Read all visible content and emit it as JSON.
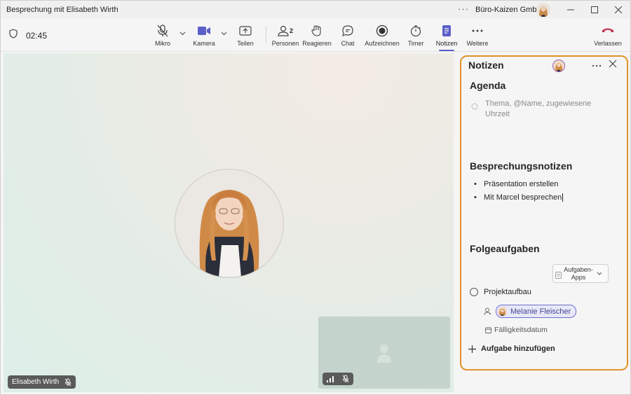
{
  "window": {
    "title": "Besprechung mit Elisabeth Wirth",
    "more": "···",
    "org": "Büro-Kaizen GmbH"
  },
  "toolbar": {
    "elapsed": "02:45",
    "mic_label": "Mikro",
    "camera_label": "Kamera",
    "share_label": "Teilen",
    "people_label": "Personen",
    "people_count": "2",
    "react_label": "Reagieren",
    "chat_label": "Chat",
    "record_label": "Aufzeichnen",
    "timer_label": "Timer",
    "notes_label": "Notizen",
    "more_label": "Weitere",
    "leave_label": "Verlassen",
    "accent_color": "#5b5fc7",
    "leave_color": "#c4314b"
  },
  "stage": {
    "participant_name": "Elisabeth Wirth"
  },
  "notes": {
    "title": "Notizen",
    "agenda_heading": "Agenda",
    "agenda_placeholder": "Thema, @Name, zugewiesene Uhrzeit",
    "meeting_notes_heading": "Besprechungsnotizen",
    "meeting_notes": [
      "Präsentation erstellen",
      "Mit Marcel besprechen"
    ],
    "followup_heading": "Folgeaufgaben",
    "task_apps_label": "Aufgaben-Apps",
    "task_title": "Projektaufbau",
    "assignee": "Melanie Fleischer",
    "due_label": "Fälligkeitsdatum",
    "add_task_label": "Aufgabe hinzufügen",
    "border_color": "#e0922b"
  }
}
